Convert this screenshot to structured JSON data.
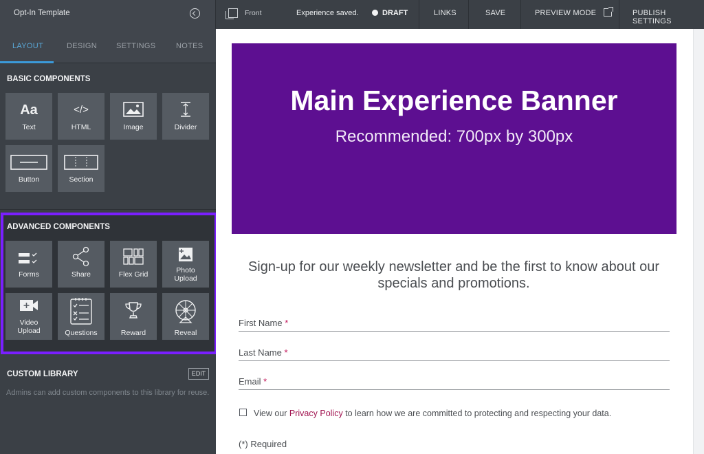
{
  "topbar": {
    "template_name": "Opt-In Template",
    "front_label": "Front",
    "status_text": "Experience saved.",
    "draft_label": "DRAFT",
    "links_label": "LINKS",
    "save_label": "SAVE",
    "preview_label": "PREVIEW MODE",
    "publish_label": "PUBLISH SETTINGS"
  },
  "sidebar": {
    "tabs": [
      {
        "label": "LAYOUT",
        "active": true
      },
      {
        "label": "DESIGN",
        "active": false
      },
      {
        "label": "SETTINGS",
        "active": false
      },
      {
        "label": "NOTES",
        "active": false
      }
    ],
    "basic": {
      "title": "BASIC COMPONENTS",
      "items": [
        {
          "label": "Text",
          "icon": "text-icon",
          "glyph": "Aa"
        },
        {
          "label": "HTML",
          "icon": "code-icon",
          "glyph": "</>"
        },
        {
          "label": "Image",
          "icon": "image-icon"
        },
        {
          "label": "Divider",
          "icon": "divider-icon"
        },
        {
          "label": "Button",
          "icon": "button-icon"
        },
        {
          "label": "Section",
          "icon": "section-icon"
        }
      ]
    },
    "advanced": {
      "title": "ADVANCED COMPONENTS",
      "highlight_color": "#7a1fff",
      "items": [
        {
          "label": "Forms",
          "icon": "forms-icon"
        },
        {
          "label": "Share",
          "icon": "share-icon"
        },
        {
          "label": "Flex Grid",
          "icon": "flex-grid-icon"
        },
        {
          "label": "Photo Upload",
          "line1": "Photo",
          "line2": "Upload",
          "icon": "photo-upload-icon"
        },
        {
          "label": "Video Upload",
          "line1": "Video",
          "line2": "Upload",
          "icon": "video-upload-icon"
        },
        {
          "label": "Questions",
          "icon": "questions-icon"
        },
        {
          "label": "Reward",
          "icon": "trophy-icon"
        },
        {
          "label": "Reveal",
          "icon": "prize-wheel-icon"
        }
      ]
    },
    "custom_library": {
      "title": "CUSTOM LIBRARY",
      "edit_label": "EDIT",
      "description": "Admins can add custom components to this library for reuse."
    }
  },
  "canvas": {
    "banner": {
      "title": "Main Experience Banner",
      "subtitle": "Recommended: 700px by 300px",
      "color": "#5d0f91"
    },
    "headline": "Sign-up for our weekly newsletter and be the first to know about our specials and promotions.",
    "fields": [
      {
        "label": "First Name",
        "required": "*"
      },
      {
        "label": "Last Name",
        "required": "*"
      },
      {
        "label": "Email",
        "required": "*"
      }
    ],
    "privacy": {
      "before": "View our",
      "link": "Privacy Policy",
      "after": "to learn how we are committed to protecting and respecting your data."
    },
    "required_note": "(*) Required"
  }
}
